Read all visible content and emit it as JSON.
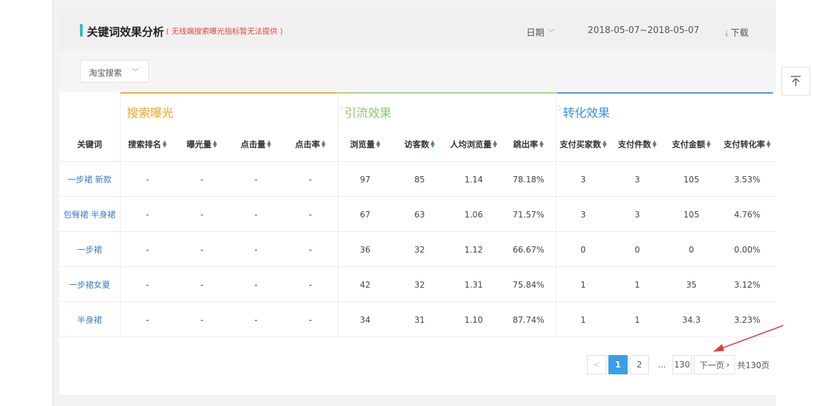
{
  "header": {
    "title": "关键词效果分析",
    "note": "( 无线端搜索曝光指标暂无法提供 )",
    "date_label": "日期",
    "date_range": "2018-05-07~2018-05-07",
    "download_label": "下载"
  },
  "filter": {
    "selected": "淘宝搜索"
  },
  "groups": [
    {
      "label": "搜索曝光",
      "color": "#f5a623"
    },
    {
      "label": "引流效果",
      "color": "#8fc36f"
    },
    {
      "label": "转化效果",
      "color": "#3a8ee6"
    }
  ],
  "columns": [
    "关键词",
    "搜索排名",
    "曝光量",
    "点击量",
    "点击率",
    "浏览量",
    "访客数",
    "人均浏览量",
    "跳出率",
    "支付买家数",
    "支付件数",
    "支付金额",
    "支付转化率"
  ],
  "rows": [
    [
      "一步裙 新款",
      "-",
      "-",
      "-",
      "-",
      "97",
      "85",
      "1.14",
      "78.18%",
      "3",
      "3",
      "105",
      "3.53%"
    ],
    [
      "包臀裙 半身裙",
      "-",
      "-",
      "-",
      "-",
      "67",
      "63",
      "1.06",
      "71.57%",
      "3",
      "3",
      "105",
      "4.76%"
    ],
    [
      "一步裙",
      "-",
      "-",
      "-",
      "-",
      "36",
      "32",
      "1.12",
      "66.67%",
      "0",
      "0",
      "0",
      "0.00%"
    ],
    [
      "一步裙女夏",
      "-",
      "-",
      "-",
      "-",
      "42",
      "32",
      "1.31",
      "75.84%",
      "1",
      "1",
      "35",
      "3.12%"
    ],
    [
      "半身裙",
      "-",
      "-",
      "-",
      "-",
      "34",
      "31",
      "1.10",
      "87.74%",
      "1",
      "1",
      "34.3",
      "3.23%"
    ]
  ],
  "pagination": {
    "prev": "<",
    "pages": [
      "1",
      "2"
    ],
    "ellipsis": "...",
    "last_page": "130",
    "next": "下一页",
    "total": "共130页",
    "current": 1
  },
  "icons": {
    "date_chevron": "chevron-down-icon",
    "download": "download-icon",
    "sort": "sort-icon",
    "back_to_top": "back-to-top-icon"
  },
  "colors": {
    "accent_blue": "#3a9ee8",
    "title_bar": "#1dc4c7",
    "note_red": "#e64545",
    "annotation_arrow": "#e53935"
  }
}
